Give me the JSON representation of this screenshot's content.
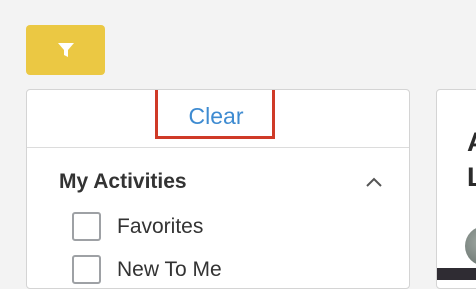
{
  "filter_button": {
    "icon": "filter-icon",
    "color": "#ebc843"
  },
  "panel": {
    "clear_label": "Clear",
    "highlight_color": "#cf3a27",
    "section": {
      "title": "My Activities",
      "expanded": true,
      "options": [
        {
          "label": "Favorites",
          "checked": false
        },
        {
          "label": "New To Me",
          "checked": false
        }
      ]
    }
  },
  "card": {
    "title": "A\nL"
  },
  "colors": {
    "link": "#3e8bd1",
    "text": "#333333"
  }
}
